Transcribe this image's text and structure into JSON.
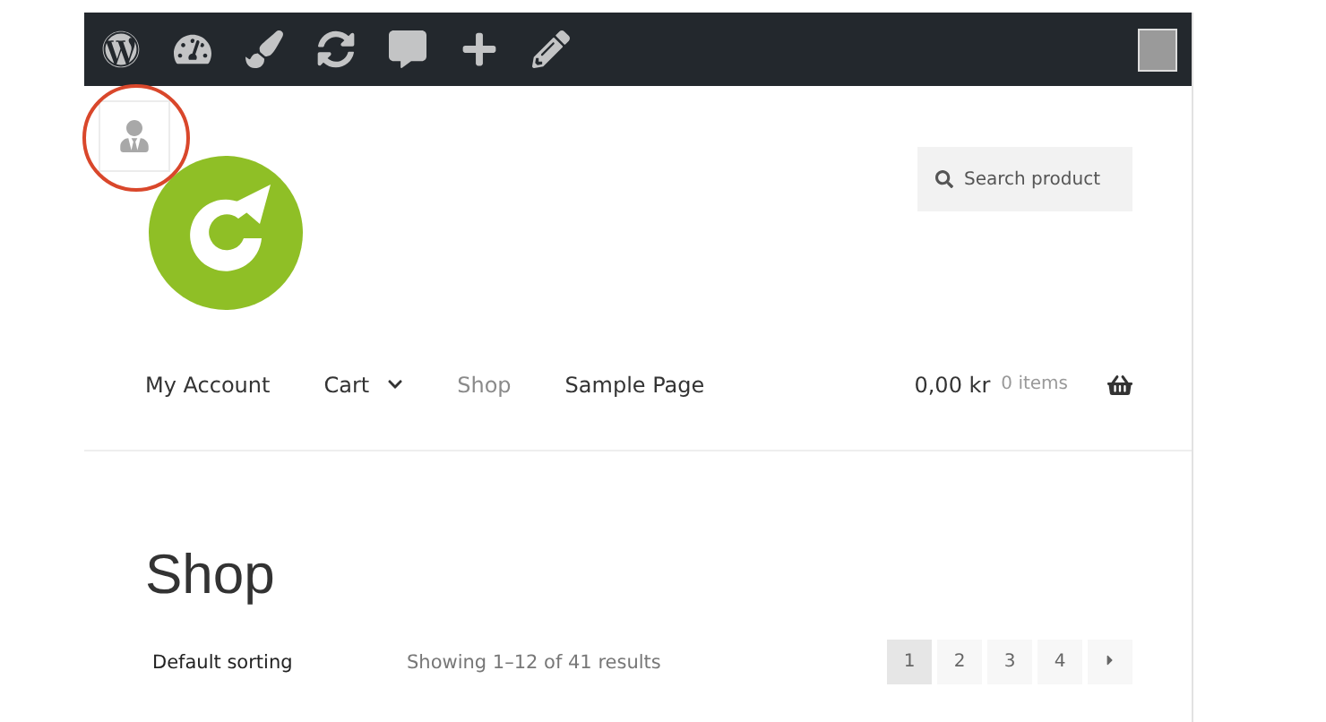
{
  "admin_bar": {
    "icons": [
      {
        "kind": "wordpress"
      },
      {
        "kind": "dashboard"
      },
      {
        "kind": "brush"
      },
      {
        "kind": "refresh"
      },
      {
        "kind": "comment"
      },
      {
        "kind": "plus"
      },
      {
        "kind": "pencil"
      }
    ]
  },
  "search": {
    "placeholder": "Search product"
  },
  "nav": [
    {
      "label": "My Account",
      "selected": false,
      "dropdown": false
    },
    {
      "label": "Cart",
      "selected": false,
      "dropdown": true
    },
    {
      "label": "Shop",
      "selected": true,
      "dropdown": false
    },
    {
      "label": "Sample Page",
      "selected": false,
      "dropdown": false
    }
  ],
  "cart": {
    "amount": "0,00 kr",
    "count": "0 items"
  },
  "page_title": "Shop",
  "sorting": "Default sorting",
  "result_count": "Showing 1–12 of 41 results",
  "pagination": [
    {
      "label": "1",
      "selected": true
    },
    {
      "label": "2",
      "selected": false
    },
    {
      "label": "3",
      "selected": false
    },
    {
      "label": "4",
      "selected": false
    }
  ]
}
